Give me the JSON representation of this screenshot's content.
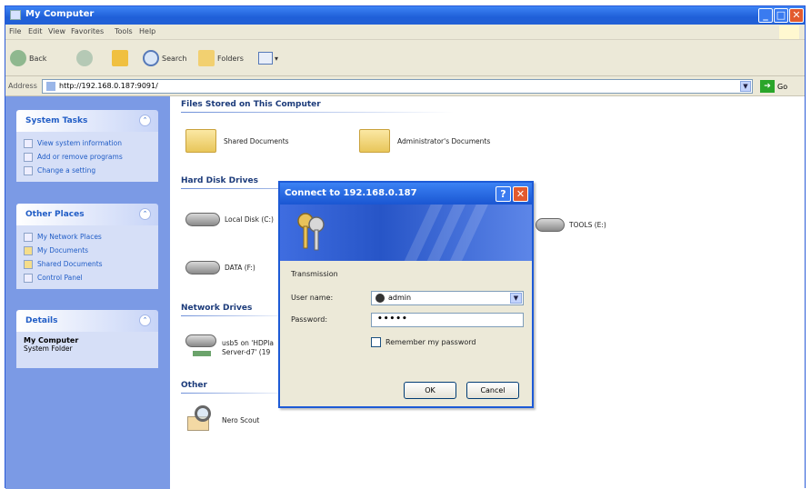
{
  "window": {
    "title": "My Computer"
  },
  "menu": [
    "File",
    "Edit",
    "View",
    "Favorites",
    "Tools",
    "Help"
  ],
  "toolbar": {
    "back": "Back",
    "search": "Search",
    "folders": "Folders"
  },
  "address": {
    "label": "Address",
    "value": "http://192.168.0.187:9091/",
    "go": "Go"
  },
  "sidebar": {
    "system_tasks": {
      "title": "System Tasks",
      "items": [
        "View system information",
        "Add or remove programs",
        "Change a setting"
      ]
    },
    "other_places": {
      "title": "Other Places",
      "items": [
        "My Network Places",
        "My Documents",
        "Shared Documents",
        "Control Panel"
      ]
    },
    "details": {
      "title": "Details",
      "name": "My Computer",
      "type": "System Folder"
    }
  },
  "content": {
    "files_group": "Files Stored on This Computer",
    "files": [
      "Shared Documents",
      "Administrator's Documents"
    ],
    "hdd_group": "Hard Disk Drives",
    "drives": [
      "Local Disk (C:)",
      "DATA (F:)",
      "TOOLS (E:)"
    ],
    "net_group": "Network Drives",
    "net_drive": {
      "line1": "usb5 on 'HDPla",
      "line2": "Server-d7' (19"
    },
    "other_group": "Other",
    "other_item": "Nero Scout"
  },
  "dialog": {
    "title": "Connect to 192.168.0.187",
    "message": "Transmission",
    "user_label": "User name:",
    "user_value": "admin",
    "pass_label": "Password:",
    "pass_value": "•••••",
    "remember_label": "Remember my password",
    "ok": "OK",
    "cancel": "Cancel"
  }
}
